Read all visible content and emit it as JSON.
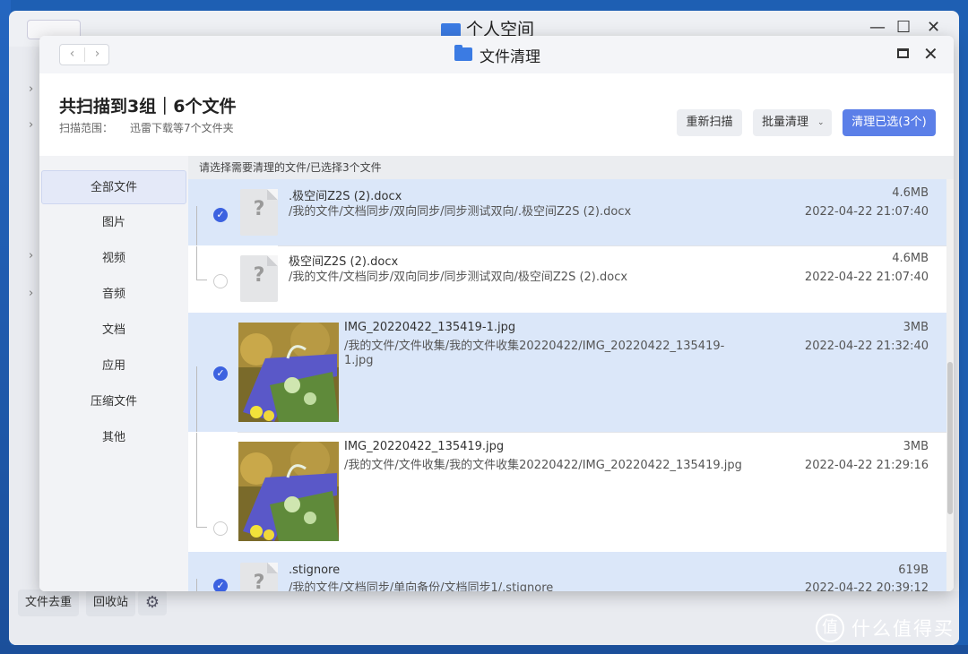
{
  "back_window": {
    "title": "个人空间",
    "bottom_buttons": [
      "文件去重",
      "回收站"
    ]
  },
  "dialog": {
    "title": "文件清理",
    "summary": "共扫描到3组｜6个文件",
    "scope_label": "扫描范围：",
    "scope_value": "迅雷下载等7个文件夹",
    "buttons": {
      "rescan": "重新扫描",
      "batch": "批量清理",
      "clean_selected": "清理已选(3个)"
    },
    "sidebar": [
      "全部文件",
      "图片",
      "视频",
      "音频",
      "文档",
      "应用",
      "压缩文件",
      "其他"
    ],
    "hint": "请选择需要清理的文件/已选择3个文件",
    "files": [
      {
        "name": ".极空间Z2S (2).docx",
        "path": "/我的文件/文档同步/双向同步/同步测试双向/.极空间Z2S (2).docx",
        "size": "4.6MB",
        "date": "2022-04-22 21:07:40",
        "checked": true
      },
      {
        "name": "极空间Z2S (2).docx",
        "path": "/我的文件/文档同步/双向同步/同步测试双向/极空间Z2S (2).docx",
        "size": "4.6MB",
        "date": "2022-04-22 21:07:40",
        "checked": false
      },
      {
        "name": "IMG_20220422_135419-1.jpg",
        "path": "/我的文件/文件收集/我的文件收集20220422/IMG_20220422_135419-1.jpg",
        "size": "3MB",
        "date": "2022-04-22 21:32:40",
        "checked": true
      },
      {
        "name": "IMG_20220422_135419.jpg",
        "path": "/我的文件/文件收集/我的文件收集20220422/IMG_20220422_135419.jpg",
        "size": "3MB",
        "date": "2022-04-22 21:29:16",
        "checked": false
      },
      {
        "name": ".stignore",
        "path": "/我的文件/文档同步/单向备份/文档同步1/.stignore",
        "size": "619B",
        "date": "2022-04-22 20:39:12",
        "checked": true
      }
    ]
  },
  "watermark": "什么值得买",
  "colors": {
    "accent": "#5b7fe8",
    "selected_row": "#dbe7f9",
    "check": "#3c62e0"
  }
}
